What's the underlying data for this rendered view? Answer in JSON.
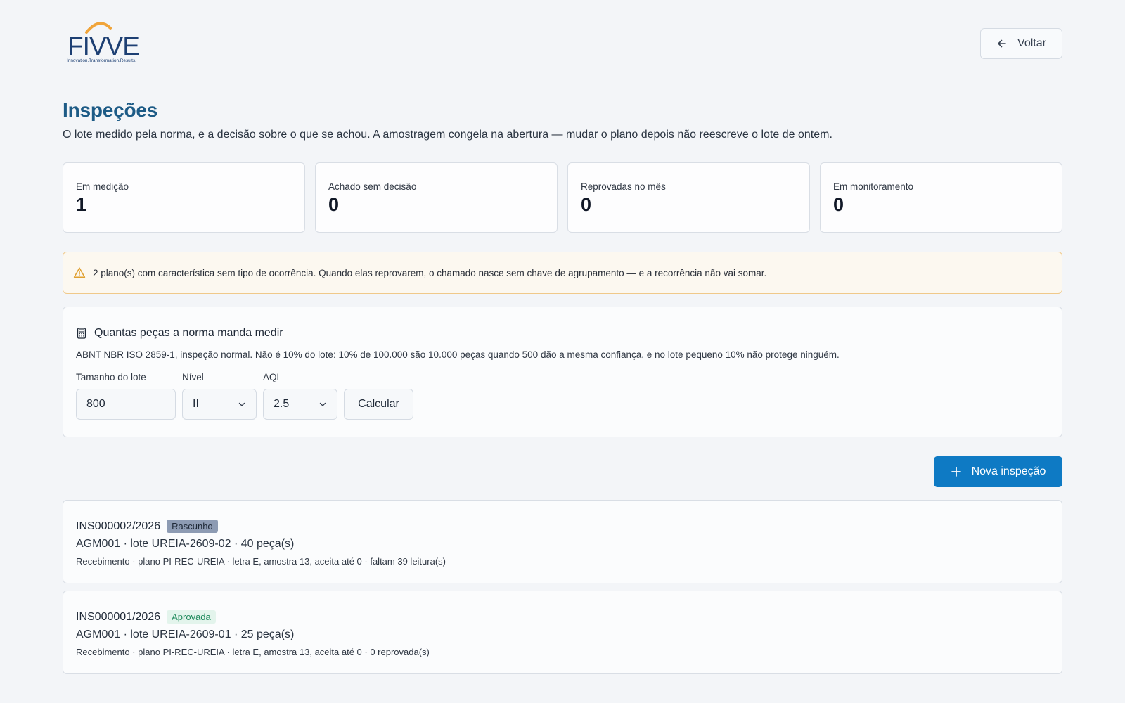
{
  "brand": {
    "name": "FIVVE",
    "tagline": "Innovation.Transformation.Results.",
    "colors": {
      "text": "#1d3f73",
      "arc": "#f0a43a"
    }
  },
  "header": {
    "back_label": "Voltar",
    "back_icon": "arrow-left-icon"
  },
  "page": {
    "title": "Inspeções",
    "subtitle": "O lote medido pela norma, e a decisão sobre o que se achou. A amostragem congela na abertura — mudar o plano depois não reescreve o lote de ontem."
  },
  "stats": [
    {
      "label": "Em medição",
      "value": "1"
    },
    {
      "label": "Achado sem decisão",
      "value": "0"
    },
    {
      "label": "Reprovadas no mês",
      "value": "0"
    },
    {
      "label": "Em monitoramento",
      "value": "0"
    }
  ],
  "alert": {
    "icon": "warning-triangle-icon",
    "text": "2 plano(s) com característica sem tipo de ocorrência. Quando elas reprovarem, o chamado nasce sem chave de agrupamento — e a recorrência não vai somar."
  },
  "calculator": {
    "icon": "calculator-icon",
    "title": "Quantas peças a norma manda medir",
    "description": "ABNT NBR ISO 2859-1, inspeção normal. Não é 10% do lote: 10% de 100.000 são 10.000 peças quando 500 dão a mesma confiança, e no lote pequeno 10% não protege ninguém.",
    "lot_size": {
      "label": "Tamanho do lote",
      "value": "800"
    },
    "level": {
      "label": "Nível",
      "value": "II"
    },
    "aql": {
      "label": "AQL",
      "value": "2.5"
    },
    "button_label": "Calcular"
  },
  "new_button": {
    "label": "Nova inspeção",
    "icon": "plus-icon"
  },
  "inspections": [
    {
      "code": "INS000002/2026",
      "status": "Rascunho",
      "main": "AGM001 · lote UREIA-2609-02 · 40 peça(s)",
      "details": "Recebimento · plano PI-REC-UREIA · letra E, amostra 13, aceita até 0 · faltam 39 leitura(s)"
    },
    {
      "code": "INS000001/2026",
      "status": "Aprovada",
      "main": "AGM001 · lote UREIA-2609-01 · 25 peça(s)",
      "details": "Recebimento · plano PI-REC-UREIA · letra E, amostra 13, aceita até 0 · 0 reprovada(s)"
    }
  ],
  "colors": {
    "background": "#f3f5f8",
    "title": "#1d5b86",
    "primary": "#0e7ac4",
    "alert_border": "#f0c98a",
    "warning_icon": "#e0a030",
    "badge_draft": "#8d9bb3",
    "badge_approved_bg": "#e3f4ec",
    "badge_approved_text": "#1f8a5c"
  }
}
